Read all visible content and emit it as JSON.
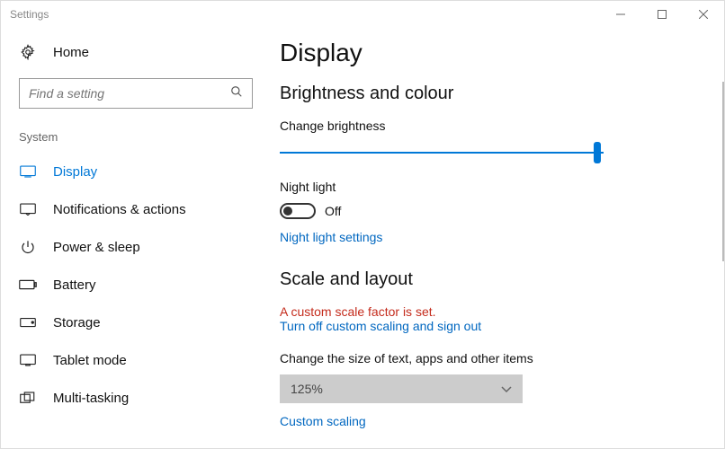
{
  "window": {
    "title": "Settings"
  },
  "sidebar": {
    "home_label": "Home",
    "search_placeholder": "Find a setting",
    "category": "System",
    "items": [
      {
        "label": "Display",
        "active": true
      },
      {
        "label": "Notifications & actions"
      },
      {
        "label": "Power & sleep"
      },
      {
        "label": "Battery"
      },
      {
        "label": "Storage"
      },
      {
        "label": "Tablet mode"
      },
      {
        "label": "Multi-tasking"
      }
    ]
  },
  "main": {
    "title": "Display",
    "brightness_section": "Brightness and colour",
    "brightness_label": "Change brightness",
    "brightness_value_pct": 98,
    "night_light_label": "Night light",
    "night_light_state": "Off",
    "night_light_settings_link": "Night light settings",
    "scale_section": "Scale and layout",
    "scale_warning": "A custom scale factor is set.",
    "scale_turn_off_link": "Turn off custom scaling and sign out",
    "scale_size_label": "Change the size of text, apps and other items",
    "scale_value": "125%",
    "custom_scaling_link": "Custom scaling"
  }
}
